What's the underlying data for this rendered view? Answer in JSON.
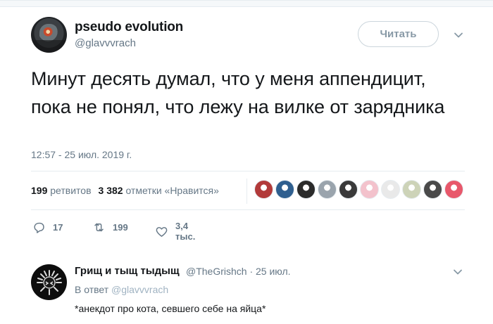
{
  "tweet": {
    "author_name": "pseudo evolution",
    "author_handle": "@glavvvrach",
    "follow_label": "Читать",
    "text": "Минут десять думал, что у меня аппендицит, пока не понял, что лежу на вилке от зарядника",
    "timestamp": "12:57 - 25 июл. 2019 г.",
    "stats": {
      "retweets_count": "199",
      "retweets_label": "ретвитов",
      "likes_count": "3 382",
      "likes_label": "отметки «Нравится»"
    },
    "liker_avatars": [
      {
        "name": "liker-avatar-1",
        "color": "#b23a3a"
      },
      {
        "name": "liker-avatar-2",
        "color": "#2f5f8f"
      },
      {
        "name": "liker-avatar-3",
        "color": "#2b2b2b"
      },
      {
        "name": "liker-avatar-4",
        "color": "#9aa4ad"
      },
      {
        "name": "liker-avatar-5",
        "color": "#3a3a3a"
      },
      {
        "name": "liker-avatar-6",
        "color": "#f3c2cc"
      },
      {
        "name": "liker-avatar-7",
        "color": "#e9e9e9"
      },
      {
        "name": "liker-avatar-8",
        "color": "#cdd3b8"
      },
      {
        "name": "liker-avatar-9",
        "color": "#4a4a4a"
      },
      {
        "name": "liker-avatar-10",
        "color": "#e8586b"
      }
    ],
    "actions": {
      "reply_count": "17",
      "retweet_count": "199",
      "like_count": "3,4 тыс."
    }
  },
  "reply": {
    "author_name": "Грищ и тыщ тыдыщ",
    "author_handle": "@TheGrishch",
    "date": "· 25 июл.",
    "reply_to_prefix": "В ответ",
    "reply_to_handle": "@glavvvrach",
    "text": "*анекдот про кота, севшего себе на яйца*"
  },
  "colors": {
    "primary_text": "#14171a",
    "secondary_text": "#657786",
    "divider": "#e6ecf0",
    "button_border": "#cbd5dc"
  },
  "icons": [
    "chevron-down-icon",
    "reply-icon",
    "retweet-icon",
    "heart-icon"
  ]
}
